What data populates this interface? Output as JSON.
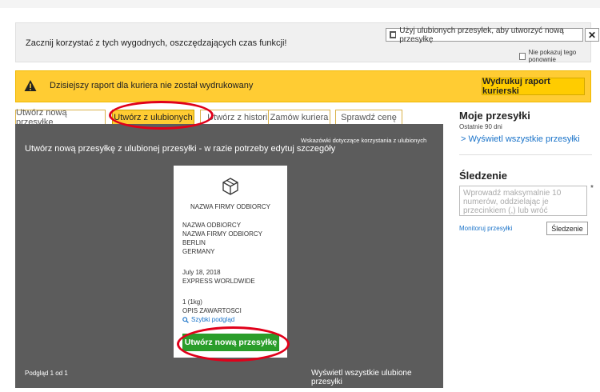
{
  "promo": {
    "text": "Zacznij korzystać z tych wygodnych, oszczędzających czas funkcji!",
    "use_favorites_button": "Użyj ulubionych przesyłek, aby utworzyć nową przesyłkę",
    "close_label": "✕",
    "dont_show_label": "Nie pokazuj tego ponownie"
  },
  "alert": {
    "text": "Dzisiejszy raport dla kuriera nie został wydrukowany",
    "button": "Wydrukuj raport kurierski",
    "color": "#ffcc33"
  },
  "tabs": [
    {
      "label": "Utwórz nową przesyłkę",
      "active": false
    },
    {
      "label": "Utwórz z ulubionych",
      "active": true
    },
    {
      "label": "Utwórz z historii",
      "active": false
    },
    {
      "label": "Zamów kuriera",
      "active": false
    },
    {
      "label": "Sprawdź cenę",
      "active": false
    }
  ],
  "panel": {
    "title": "Utwórz nową przesyłkę z ulubionej przesyłki - w razie potrzeby edytuj szczegóły",
    "hint": "Wskazówki dotyczące korzystania z ulubionych",
    "footer_left": "Podgląd 1 od 1",
    "footer_right": "Wyświetl wszystkie ulubione przesyłki"
  },
  "card": {
    "icon": "package-icon",
    "company": "NAZWA FIRMY ODBIORCY",
    "recipient_name": "NAZWA ODBIORCY",
    "recipient_company": "NAZWA FIRMY ODBIORCY",
    "city": "BERLIN",
    "country": "GERMANY",
    "date": "July 18, 2018",
    "service": "EXPRESS WORLDWIDE",
    "pieces": "1 (1kg)",
    "contents": "OPIS ZAWARTOSCI",
    "quick_view": "Szybki podgląd",
    "create_button": "Utwórz nową przesyłkę",
    "button_color": "#2a9d2a"
  },
  "sidebar": {
    "my_shipments_title": "Moje przesyłki",
    "my_shipments_sub": "Ostatnie 90 dni",
    "view_all_link": "> Wyświetl wszystkie przesyłki",
    "tracking_title": "Śledzenie",
    "tracking_placeholder": "Wprowadź maksymalnie 10 numerów, oddzielając je przecinkiem (,) lub wróć",
    "required_mark": "*",
    "monitor_link": "Monitoruj przesyłki",
    "tracking_button": "Śledzenie"
  },
  "annotations": {
    "highlight_color": "#e0001a"
  }
}
